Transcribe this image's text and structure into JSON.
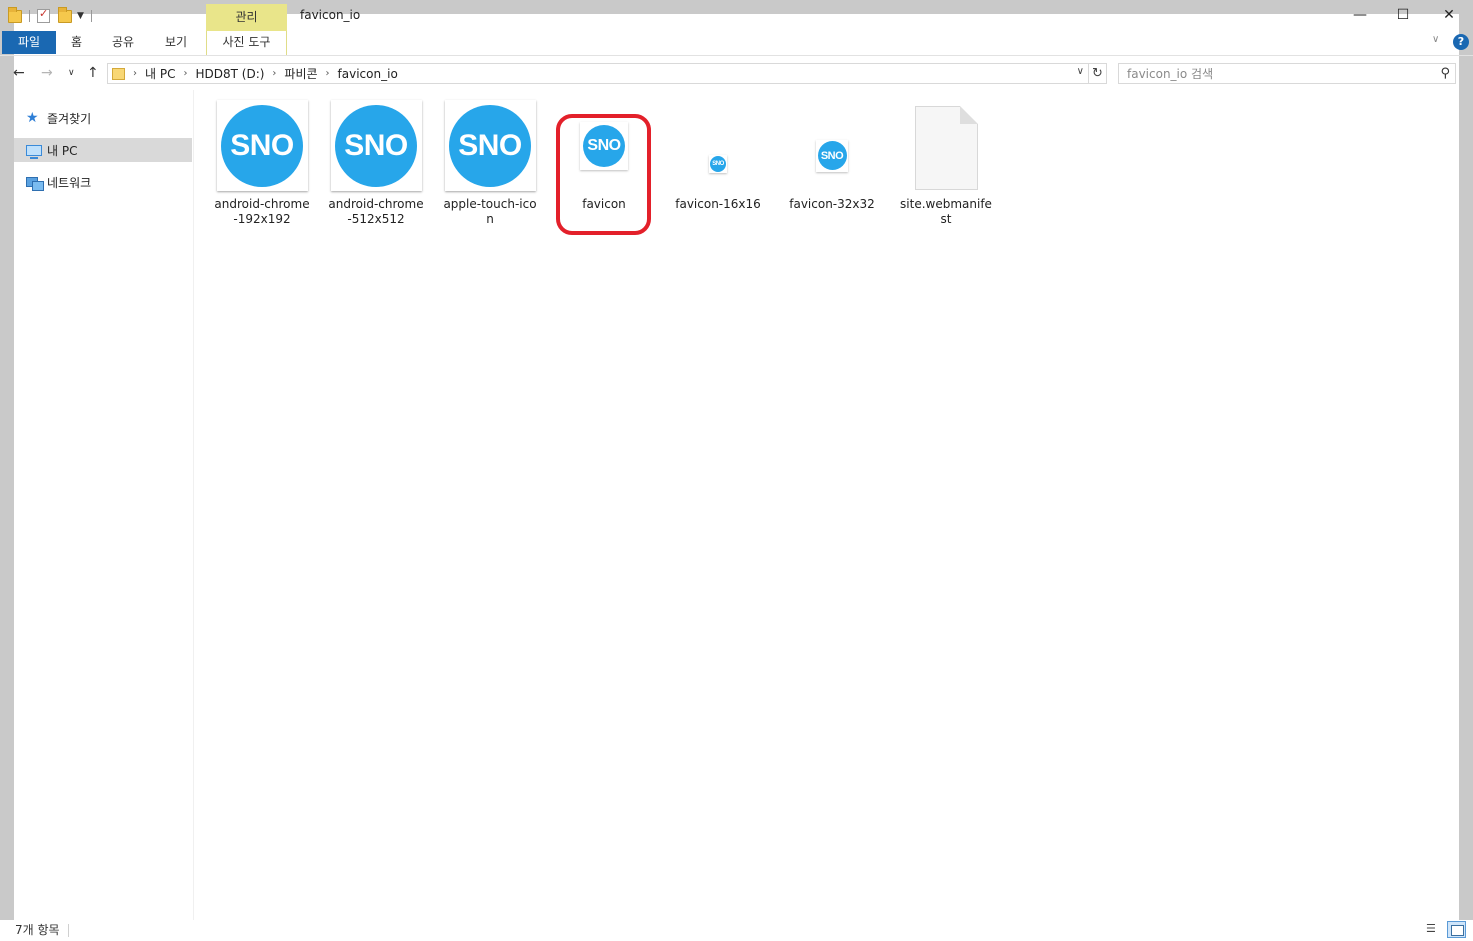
{
  "title_bar": {
    "window_title": "favicon_io",
    "manage_tab": "관리",
    "minimize": "—",
    "maximize": "☐",
    "close": "✕"
  },
  "ribbon": {
    "tabs": [
      "파일",
      "홈",
      "공유",
      "보기"
    ],
    "contextual_tab": "사진 도구",
    "expand": "∨",
    "help": "?"
  },
  "nav": {
    "back": "←",
    "forward": "→",
    "recent": "∨",
    "up": "↑",
    "breadcrumb": [
      "내 PC",
      "HDD8T (D:)",
      "파비콘",
      "favicon_io"
    ],
    "refresh": "↻"
  },
  "search": {
    "placeholder": "favicon_io 검색"
  },
  "sidebar": {
    "items": [
      {
        "label": "즐겨찾기",
        "icon": "star-icon"
      },
      {
        "label": "내 PC",
        "icon": "computer-icon",
        "selected": true
      },
      {
        "label": "네트워크",
        "icon": "network-icon"
      }
    ]
  },
  "files": [
    {
      "name": "android-chrome-192x192",
      "thumb_text": "SNO",
      "kind": "large-image"
    },
    {
      "name": "android-chrome-512x512",
      "thumb_text": "SNO",
      "kind": "large-image"
    },
    {
      "name": "apple-touch-icon",
      "thumb_text": "SNO",
      "kind": "large-image"
    },
    {
      "name": "favicon",
      "thumb_text": "SNO",
      "kind": "ico",
      "highlighted": true
    },
    {
      "name": "favicon-16x16",
      "thumb_text": "SNO",
      "kind": "tiny-image"
    },
    {
      "name": "favicon-32x32",
      "thumb_text": "SNO",
      "kind": "small-image"
    },
    {
      "name": "site.webmanifest",
      "kind": "document"
    }
  ],
  "status_bar": {
    "item_count": "7개 항목"
  },
  "colors": {
    "accent": "#1a68b2",
    "sno_blue": "#27a6ea",
    "highlight_red": "#e3202a",
    "manage_yellow": "#e9e58a"
  }
}
